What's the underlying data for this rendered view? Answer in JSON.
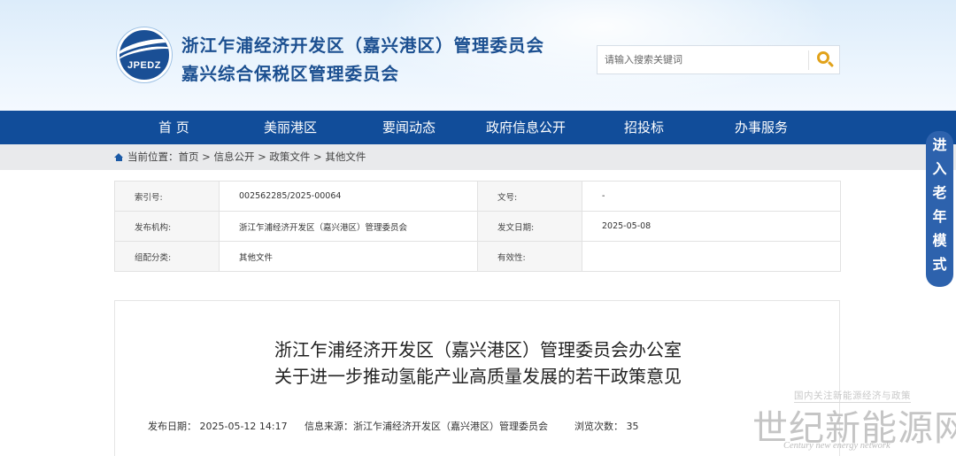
{
  "header": {
    "logo_text": "JPEDZ",
    "title_line1": "浙江乍浦经济开发区（嘉兴港区）管理委员会",
    "title_line2": "嘉兴综合保税区管理委员会",
    "search_placeholder": "请输入搜索关键词"
  },
  "nav": {
    "items": [
      {
        "label": "首 页"
      },
      {
        "label": "美丽港区"
      },
      {
        "label": "要闻动态"
      },
      {
        "label": "政府信息公开"
      },
      {
        "label": "招投标"
      },
      {
        "label": "办事服务"
      }
    ]
  },
  "breadcrumb": {
    "prefix": "当前位置：",
    "items": [
      "首页",
      "信息公开",
      "政策文件",
      "其他文件"
    ],
    "separator": " > "
  },
  "meta": {
    "index_no_label": "索引号:",
    "index_no_value": "002562285/2025-00064",
    "doc_no_label": "文号:",
    "doc_no_value": "-",
    "publisher_label": "发布机构:",
    "publisher_value": "浙江乍浦经济开发区（嘉兴港区）管理委员会",
    "issue_date_label": "发文日期:",
    "issue_date_value": "2025-05-08",
    "category_label": "组配分类:",
    "category_value": "其他文件",
    "validity_label": "有效性:",
    "validity_value": ""
  },
  "article": {
    "title_line1": "浙江乍浦经济开发区（嘉兴港区）管理委员会办公室",
    "title_line2": "关于进一步推动氢能产业高质量发展的若干政策意见",
    "publish_date": "发布日期： 2025-05-12 14:17",
    "source": "信息来源：浙江乍浦经济开发区（嘉兴港区）管理委员会",
    "views": "浏览次数： 35"
  },
  "elder_mode": {
    "chars": [
      "进",
      "入",
      "老",
      "年",
      "模",
      "式"
    ]
  },
  "watermark": {
    "subtitle": "国内关注新能源经济与政策",
    "main": "世纪新能源网",
    "english": "Century new energy network"
  },
  "colors": {
    "nav_bg": "#114d9a",
    "title_blue": "#1b4f90",
    "search_icon": "#e1a21a",
    "elder_bg": "#2d62ad"
  }
}
